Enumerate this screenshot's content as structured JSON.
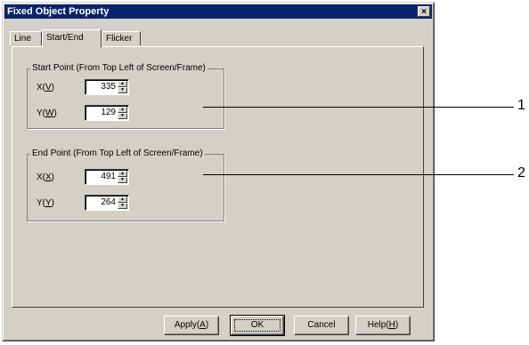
{
  "window": {
    "title": "Fixed Object Property",
    "close_glyph": "×"
  },
  "tabs": [
    {
      "label": "Line"
    },
    {
      "label": "Start/End"
    },
    {
      "label": "Flicker"
    }
  ],
  "start_point": {
    "group_label": "Start Point (From Top Left of Screen/Frame)",
    "x": {
      "label_prefix": "X(",
      "mnemonic": "V",
      "label_suffix": ")",
      "value": "335"
    },
    "y": {
      "label_prefix": "Y(",
      "mnemonic": "W",
      "label_suffix": ")",
      "value": "129"
    }
  },
  "end_point": {
    "group_label": "End Point (From Top Left of Screen/Frame)",
    "x": {
      "label_prefix": "X(",
      "mnemonic": "X",
      "label_suffix": ")",
      "value": "491"
    },
    "y": {
      "label_prefix": "Y(",
      "mnemonic": "Y",
      "label_suffix": ")",
      "value": "264"
    }
  },
  "buttons": {
    "apply": {
      "prefix": "Apply(",
      "mnemonic": "A",
      "suffix": ")"
    },
    "ok": "OK",
    "cancel": "Cancel",
    "help": {
      "prefix": "Help(",
      "mnemonic": "H",
      "suffix": ")"
    }
  },
  "callouts": {
    "one": "1",
    "two": "2"
  },
  "icons": {
    "spin_up": "spin-up-arrow-icon",
    "spin_down": "spin-down-arrow-icon"
  }
}
